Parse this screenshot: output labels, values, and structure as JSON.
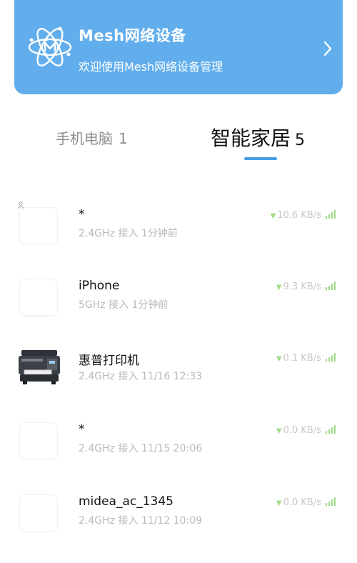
{
  "banner": {
    "title": "Mesh网络设备",
    "subtitle": "欢迎使用Mesh网络设备管理",
    "bg_color": "#62aeec",
    "logo_icon": "atom-m-logo-icon",
    "arrow_icon": "chevron-right-icon"
  },
  "tabs": [
    {
      "label": "手机电脑",
      "count": "1",
      "active": false
    },
    {
      "label": "智能家居",
      "count": "5",
      "active": true
    }
  ],
  "accent_color": "#4a9ee4",
  "devices": [
    {
      "name": "*",
      "meta": "2.4GHz 接入  1分钟前",
      "speed": "10.6 KB/s",
      "thumb": "blank",
      "has_person_icon": true
    },
    {
      "name": "iPhone",
      "meta": "5GHz 接入  1分钟前",
      "speed": "9.3 KB/s",
      "thumb": "blank",
      "has_person_icon": false
    },
    {
      "name": "惠普打印机",
      "meta": "2.4GHz 接入  11/16 12:33",
      "speed": "0.1 KB/s",
      "thumb": "printer",
      "has_person_icon": false
    },
    {
      "name": "*",
      "meta": "2.4GHz 接入  11/15 20:06",
      "speed": "0.0 KB/s",
      "thumb": "blank",
      "has_person_icon": false
    },
    {
      "name": "midea_ac_1345",
      "meta": "2.4GHz 接入  11/12 10:09",
      "speed": "0.0 KB/s",
      "thumb": "blank",
      "has_person_icon": false
    }
  ]
}
